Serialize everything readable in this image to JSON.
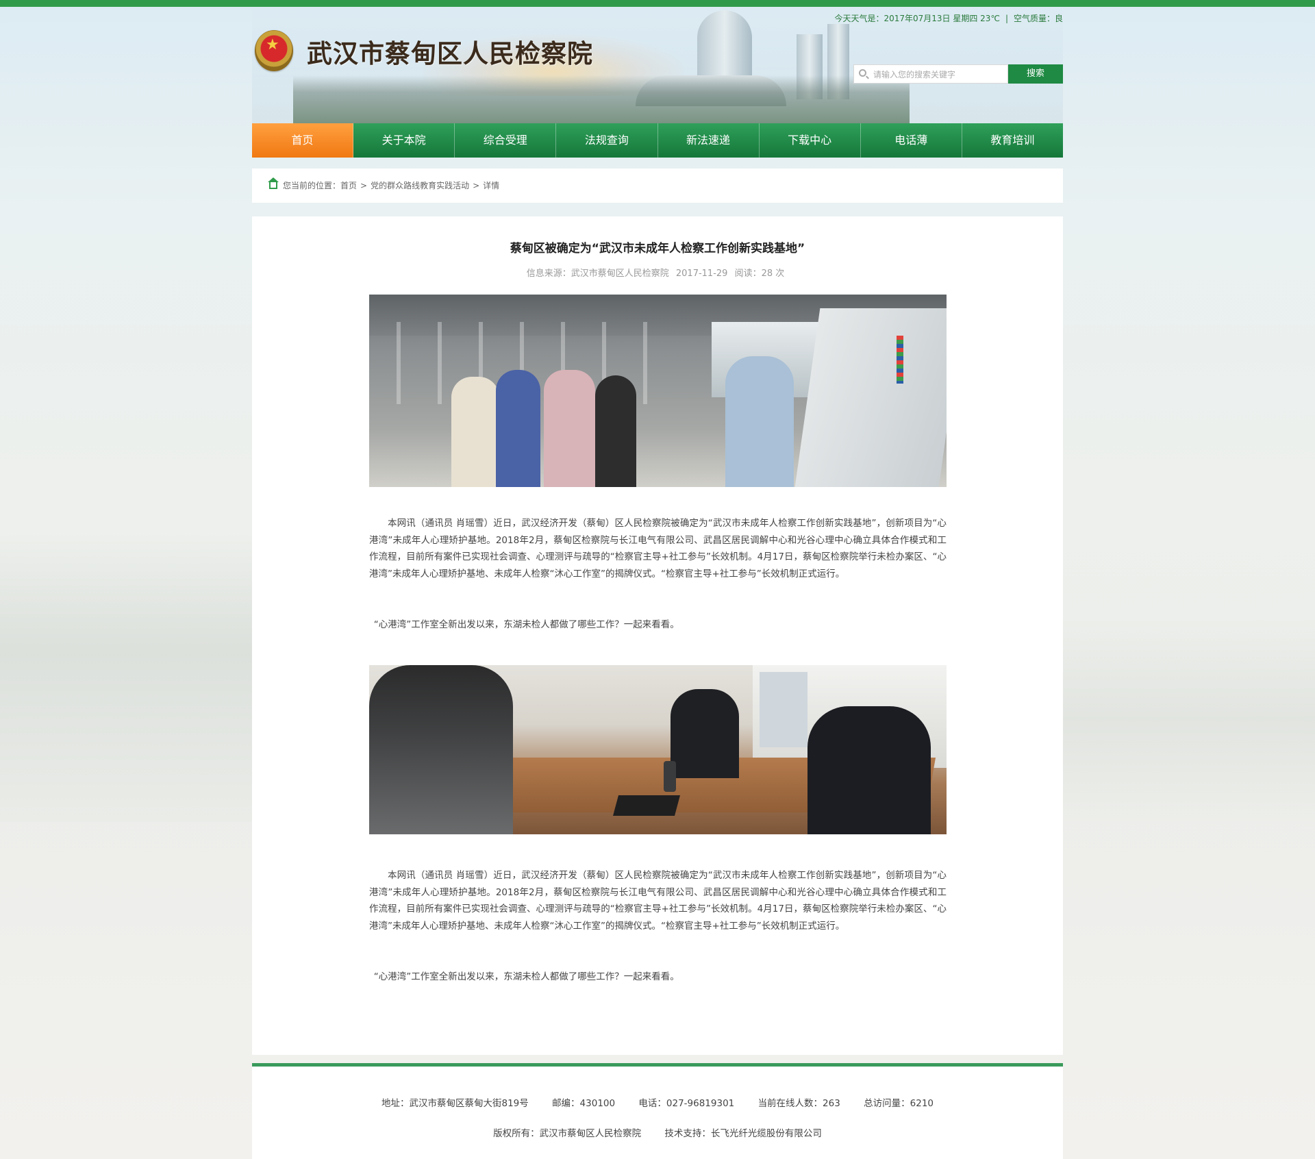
{
  "header": {
    "site_title": "武汉市蔡甸区人民检察院",
    "weather": "今天天气是：2017年07月13日 星期四  23℃",
    "air_quality": "空气质量：良",
    "search": {
      "placeholder": "请输入您的搜索关键字",
      "button_label": "搜索"
    }
  },
  "nav": {
    "items": [
      {
        "label": "首页"
      },
      {
        "label": "关于本院"
      },
      {
        "label": "综合受理"
      },
      {
        "label": "法规查询"
      },
      {
        "label": "新法速递"
      },
      {
        "label": "下载中心"
      },
      {
        "label": "电话薄"
      },
      {
        "label": "教育培训"
      }
    ],
    "active_index": 0
  },
  "breadcrumb": {
    "prefix": "您当前的位置：",
    "items": [
      "首页",
      "党的群众路线教育实践活动",
      "详情"
    ],
    "separator": ">"
  },
  "article": {
    "title": "蔡甸区被确定为“武汉市未成年人检察工作创新实践基地”",
    "source": "信息来源：武汉市蔡甸区人民检察院",
    "date": "2017-11-29",
    "reads": "阅读：28 次",
    "paragraph1": "本网讯（通讯员 肖瑶雪）近日，武汉经济开发（蔡甸）区人民检察院被确定为“武汉市未成年人检察工作创新实践基地”，创新项目为“心港湾”未成年人心理矫护基地。2018年2月，蔡甸区检察院与长江电气有限公司、武昌区居民调解中心和光谷心理中心确立具体合作模式和工作流程，目前所有案件已实现社会调查、心理测评与疏导的“检察官主导+社工参与”长效机制。4月17日，蔡甸区检察院举行未检办案区、“心港湾”未成年人心理矫护基地、未成年人检察“沐心工作室”的揭牌仪式。“检察官主导+社工参与”长效机制正式运行。",
    "paragraph2": "“心港湾”工作室全新出发以来，东湖未检人都做了哪些工作？一起来看看。",
    "paragraph3": "本网讯（通讯员 肖瑶雪）近日，武汉经济开发（蔡甸）区人民检察院被确定为“武汉市未成年人检察工作创新实践基地”，创新项目为“心港湾”未成年人心理矫护基地。2018年2月，蔡甸区检察院与长江电气有限公司、武昌区居民调解中心和光谷心理中心确立具体合作模式和工作流程，目前所有案件已实现社会调查、心理测评与疏导的“检察官主导+社工参与”长效机制。4月17日，蔡甸区检察院举行未检办案区、“心港湾”未成年人心理矫护基地、未成年人检察“沐心工作室”的揭牌仪式。“检察官主导+社工参与”长效机制正式运行。",
    "paragraph4": "“心港湾”工作室全新出发以来，东湖未检人都做了哪些工作？一起来看看。"
  },
  "footer": {
    "address": "地址：武汉市蔡甸区蔡甸大街819号",
    "postcode": "邮编：430100",
    "phone": "电话：027-96819301",
    "online": "当前在线人数：263",
    "visits": "总访问量：6210",
    "copyright": "版权所有：武汉市蔡甸区人民检察院",
    "support": "技术支持：长飞光纤光缆股份有限公司"
  },
  "colors": {
    "brand_green": "#1e8a43",
    "nav_active_orange": "#f28a22",
    "footer_rule": "#3a9a5a"
  },
  "icons": [
    "national-emblem-icon",
    "search-icon",
    "home-icon"
  ]
}
